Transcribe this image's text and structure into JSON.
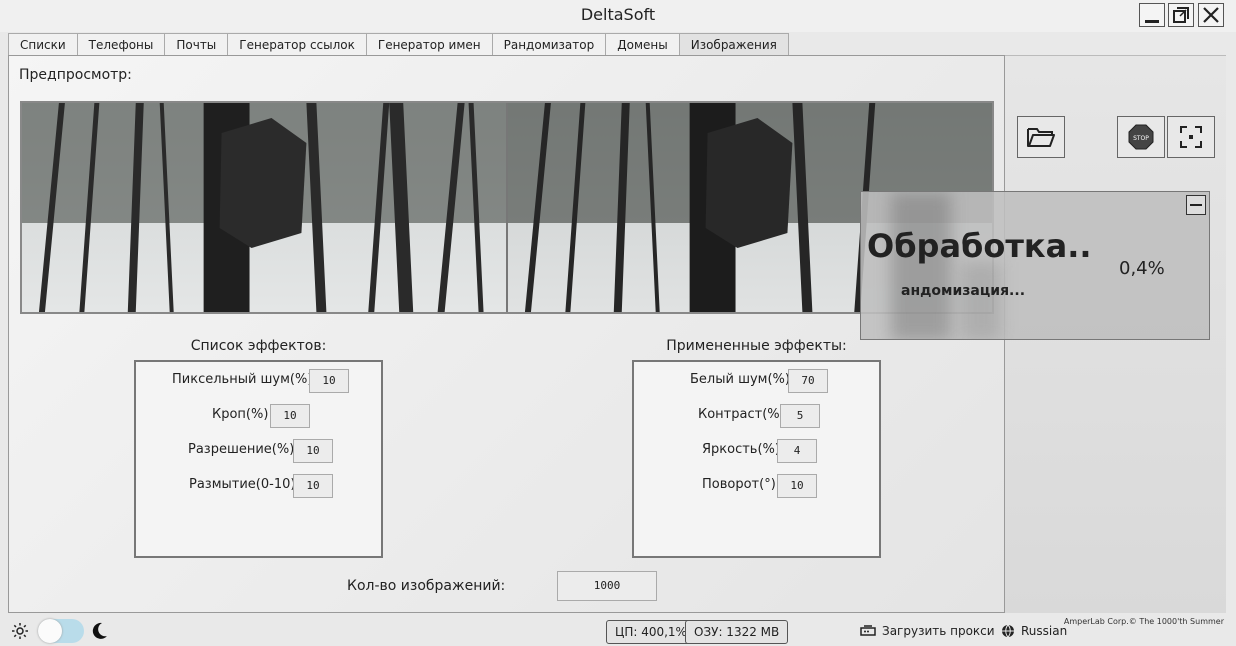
{
  "window": {
    "title": "DeltaSoft"
  },
  "tabs": [
    {
      "label": "Списки"
    },
    {
      "label": "Телефоны"
    },
    {
      "label": "Почты"
    },
    {
      "label": "Генератор ссылок"
    },
    {
      "label": "Генератор имен"
    },
    {
      "label": "Рандомизатор"
    },
    {
      "label": "Домены"
    },
    {
      "label": "Изображения",
      "active": true
    }
  ],
  "preview": {
    "label": "Предпросмотр:"
  },
  "effects_list": {
    "title": "Список эффектов:",
    "items": [
      {
        "label": "Пиксельный шум(%)",
        "value": "10"
      },
      {
        "label": "Кроп(%)",
        "value": "10"
      },
      {
        "label": "Разрешение(%)",
        "value": "10"
      },
      {
        "label": "Размытие(0-10)",
        "value": "10"
      }
    ]
  },
  "applied_effects": {
    "title": "Примененные эффекты:",
    "items": [
      {
        "label": "Белый шум(%)",
        "value": "70"
      },
      {
        "label": "Контраст(%)",
        "value": "5"
      },
      {
        "label": "Яркость(%)",
        "value": "4"
      },
      {
        "label": "Поворот(°)",
        "value": "10"
      }
    ]
  },
  "image_count": {
    "label": "Кол-во изображений:",
    "value": "1000"
  },
  "progress": {
    "title": "Обработка..",
    "percent": "0,4%",
    "subtitle": "андомизация...",
    "fraction": 0.004
  },
  "status": {
    "cpu": "ЦП: 400,1%",
    "ram": "ОЗУ: 1322 MB",
    "proxy_label": "Загрузить прокси",
    "language": "Russian",
    "copyright": "AmperLab Corp.© The 1000'th Summer"
  },
  "icons": {
    "folder": "folder-open-icon",
    "stop": "stop-sign-icon",
    "fullscreen": "fullscreen-icon",
    "theme_light": "sun-icon",
    "theme_dark": "moon-icon"
  }
}
